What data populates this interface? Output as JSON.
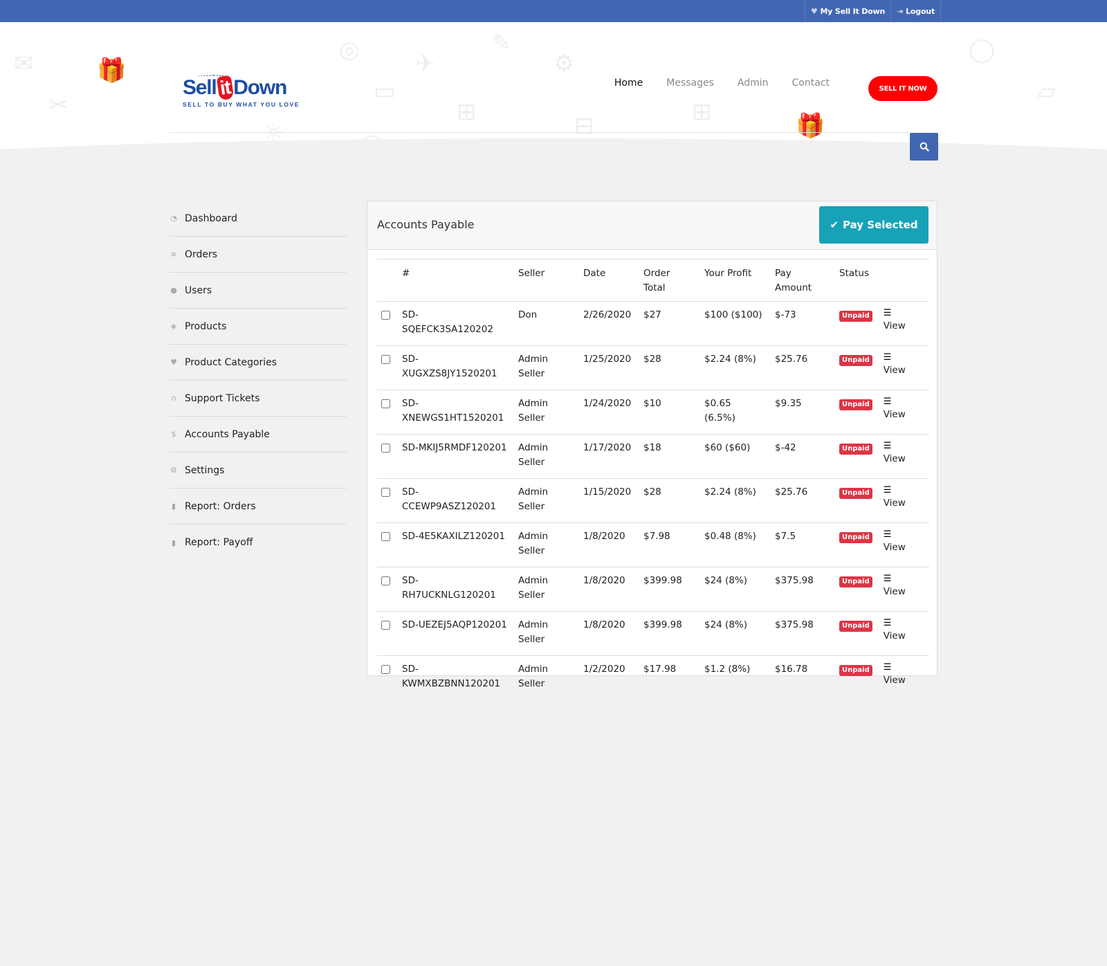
{
  "topbar": {
    "links": [
      {
        "icon": "heart-icon",
        "label": "My Sell It Down"
      },
      {
        "icon": "logout-icon",
        "label": "Logout"
      }
    ]
  },
  "header": {
    "logo": {
      "part1": "Sell",
      "part2": "it",
      "part3": "Down",
      "tagline": "SELL TO BUY WHAT YOU LOVE"
    },
    "nav": [
      {
        "label": "Home",
        "active": true
      },
      {
        "label": "Messages",
        "active": false
      },
      {
        "label": "Admin",
        "active": false
      },
      {
        "label": "Contact",
        "active": false
      }
    ],
    "cta_label": "SELL IT NOW",
    "search": {
      "placeholder": "",
      "value": ""
    }
  },
  "sidebar": {
    "items": [
      {
        "icon": "dashboard-icon",
        "label": "Dashboard"
      },
      {
        "icon": "list-icon",
        "label": "Orders"
      },
      {
        "icon": "user-icon",
        "label": "Users"
      },
      {
        "icon": "tags-icon",
        "label": "Products"
      },
      {
        "icon": "heart-icon",
        "label": "Product Categories"
      },
      {
        "icon": "headset-icon",
        "label": "Support Tickets"
      },
      {
        "icon": "dollar-icon",
        "label": "Accounts Payable"
      },
      {
        "icon": "cogs-icon",
        "label": "Settings"
      },
      {
        "icon": "file-icon",
        "label": "Report: Orders"
      },
      {
        "icon": "file-icon",
        "label": "Report: Payoff"
      }
    ]
  },
  "panel": {
    "title": "Accounts Payable",
    "pay_button": "Pay Selected",
    "columns": [
      "#",
      "Seller",
      "Date",
      "Order Total",
      "Your Profit",
      "Pay Amount",
      "Status",
      ""
    ],
    "rows": [
      {
        "id": "SD-SQEFCK3SA120202",
        "seller": "Don",
        "date": "2/26/2020",
        "total": "$27",
        "profit": "$100 ($100)",
        "pay": "$-73",
        "status": "Unpaid",
        "action": "View"
      },
      {
        "id": "SD-XUGXZS8JY1520201",
        "seller": "Admin Seller",
        "date": "1/25/2020",
        "total": "$28",
        "profit": "$2.24 (8%)",
        "pay": "$25.76",
        "status": "Unpaid",
        "action": "View"
      },
      {
        "id": "SD-XNEWGS1HT1520201",
        "seller": "Admin Seller",
        "date": "1/24/2020",
        "total": "$10",
        "profit": "$0.65 (6.5%)",
        "pay": "$9.35",
        "status": "Unpaid",
        "action": "View"
      },
      {
        "id": "SD-MKIJ5RMDF120201",
        "seller": "Admin Seller",
        "date": "1/17/2020",
        "total": "$18",
        "profit": "$60 ($60)",
        "pay": "$-42",
        "status": "Unpaid",
        "action": "View"
      },
      {
        "id": "SD-CCEWP9ASZ120201",
        "seller": "Admin Seller",
        "date": "1/15/2020",
        "total": "$28",
        "profit": "$2.24 (8%)",
        "pay": "$25.76",
        "status": "Unpaid",
        "action": "View"
      },
      {
        "id": "SD-4E5KAXILZ120201",
        "seller": "Admin Seller",
        "date": "1/8/2020",
        "total": "$7.98",
        "profit": "$0.48 (8%)",
        "pay": "$7.5",
        "status": "Unpaid",
        "action": "View"
      },
      {
        "id": "SD-RH7UCKNLG120201",
        "seller": "Admin Seller",
        "date": "1/8/2020",
        "total": "$399.98",
        "profit": "$24 (8%)",
        "pay": "$375.98",
        "status": "Unpaid",
        "action": "View"
      },
      {
        "id": "SD-UEZEJ5AQP120201",
        "seller": "Admin Seller",
        "date": "1/8/2020",
        "total": "$399.98",
        "profit": "$24 (8%)",
        "pay": "$375.98",
        "status": "Unpaid",
        "action": "View"
      },
      {
        "id": "SD-KWMXBZBNN120201",
        "seller": "Admin Seller",
        "date": "1/2/2020",
        "total": "$17.98",
        "profit": "$1.2 (8%)",
        "pay": "$16.78",
        "status": "Unpaid",
        "action": "View"
      }
    ]
  },
  "colors": {
    "brand_blue": "#4267b2",
    "cta_red": "#ff0000",
    "pay_teal": "#17a2b8",
    "badge_red": "#dc3545"
  }
}
